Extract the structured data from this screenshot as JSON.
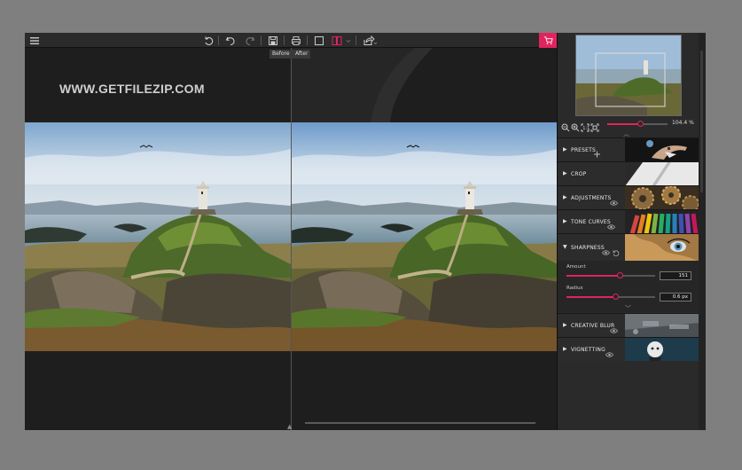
{
  "toolbar": {
    "before_label": "Before",
    "after_label": "After"
  },
  "canvas": {
    "watermark": "WWW.GETFILEZIP.COM"
  },
  "navigator": {
    "zoom_value": "104.4 %",
    "zoom_level": 0.55
  },
  "panel": {
    "sections": [
      {
        "label": "PRESETS",
        "expanded": false,
        "icon": "plus-icon"
      },
      {
        "label": "CROP",
        "expanded": false
      },
      {
        "label": "ADJUSTMENTS",
        "expanded": false,
        "icon": "eye-icon"
      },
      {
        "label": "TONE CURVES",
        "expanded": false,
        "icon": "eye-icon"
      },
      {
        "label": "SHARPNESS",
        "expanded": true,
        "icon": "eye-icon"
      },
      {
        "label": "CREATIVE BLUR",
        "expanded": false,
        "icon": "eye-icon"
      },
      {
        "label": "VIGNETTING",
        "expanded": false,
        "icon": "eye-icon"
      }
    ],
    "sharpness": {
      "amount_label": "Amount",
      "amount_value": "151",
      "amount_level": 0.6,
      "radius_label": "Radius",
      "radius_value": "0.6 px",
      "radius_level": 0.55
    }
  },
  "colors": {
    "accent": "#e0245e",
    "background": "#1c1c1c",
    "panel": "#2a2a2a"
  }
}
